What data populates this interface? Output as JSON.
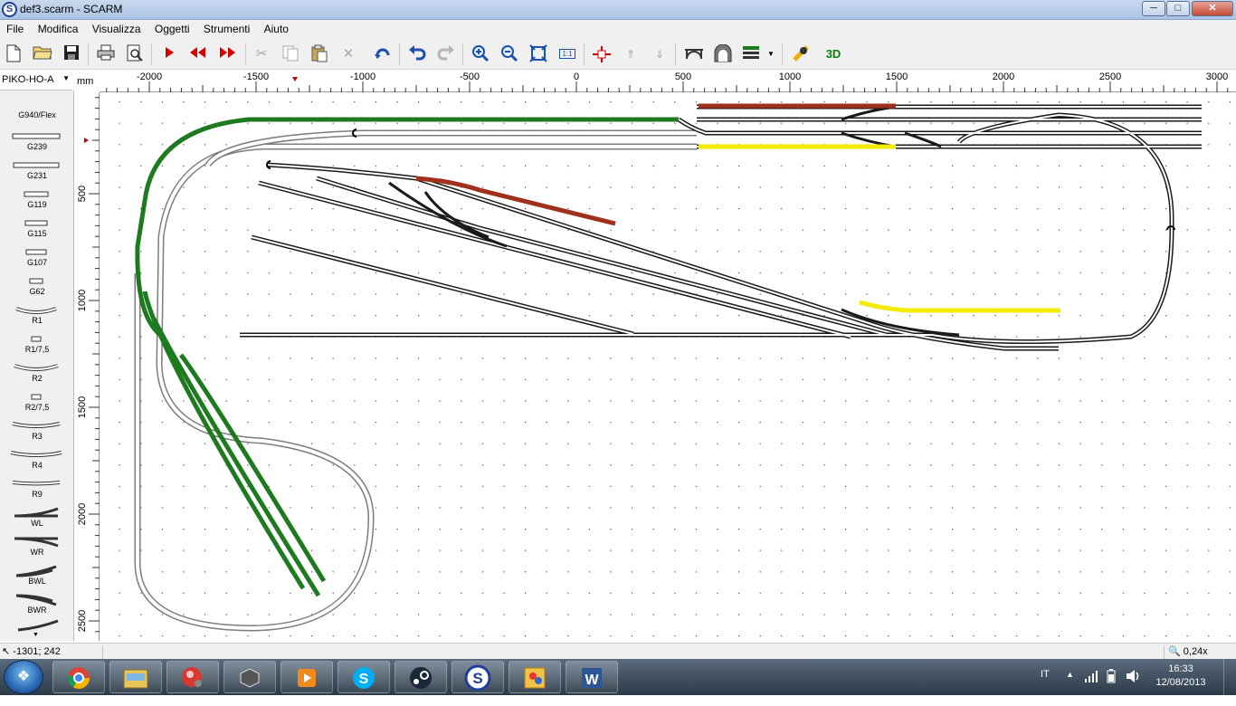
{
  "window": {
    "title": "def3.scarm - SCARM",
    "app_icon": "S",
    "min": "─",
    "max": "□",
    "close": "✕"
  },
  "menu": [
    "File",
    "Modifica",
    "Visualizza",
    "Oggetti",
    "Strumenti",
    "Aiuto"
  ],
  "toolbar_icons": [
    "new-file-icon",
    "open-folder-icon",
    "save-icon",
    "print-icon",
    "print-preview-icon",
    "play-icon",
    "rewind-icon",
    "forward-icon",
    "cut-icon",
    "copy-icon",
    "paste-icon",
    "delete-icon",
    "rotate-icon",
    "undo-icon",
    "redo-icon",
    "zoom-in-icon",
    "zoom-out-icon",
    "fit-icon",
    "zoom-1-1-icon",
    "height-icon",
    "height-up-icon",
    "height-down-icon",
    "bridge-icon",
    "tunnel-icon",
    "layers-icon",
    "measure-icon",
    "view-3d-icon"
  ],
  "toolbar": {
    "zoom_11": "1:1",
    "view3d": "3D"
  },
  "library": {
    "selected": "PIKO-HO-A",
    "unit": "mm",
    "items": [
      "G940/Flex",
      "G239",
      "G231",
      "G119",
      "G115",
      "G107",
      "G62",
      "R1",
      "R1/7,5",
      "R2",
      "R2/7,5",
      "R3",
      "R4",
      "R9",
      "WL",
      "WR",
      "BWL",
      "BWR"
    ]
  },
  "ruler": {
    "top_labels": [
      "-2000",
      "-1500",
      "-1000",
      "-500",
      "0",
      "500",
      "1000",
      "1500",
      "2000",
      "2500",
      "3000"
    ],
    "left_labels": [
      "500",
      "1000",
      "1500",
      "2000",
      "2500"
    ]
  },
  "colors": {
    "green_track": "#1e7a1e",
    "red_track": "#a0301c",
    "yellow_track": "#f2ea00",
    "grey_track": "#c4c4c4",
    "black_track": "#1a1a1a"
  },
  "status": {
    "coords": "-1301; 242",
    "zoom": "0,24x"
  },
  "taskbar": {
    "apps": [
      "chrome-icon",
      "explorer-icon",
      "media-player-icon",
      "virtualbox-icon",
      "video-player-icon",
      "skype-icon",
      "steam-icon",
      "scarm-icon",
      "paint-icon",
      "word-icon"
    ],
    "lang": "IT",
    "time": "16:33",
    "date": "12/08/2013"
  }
}
